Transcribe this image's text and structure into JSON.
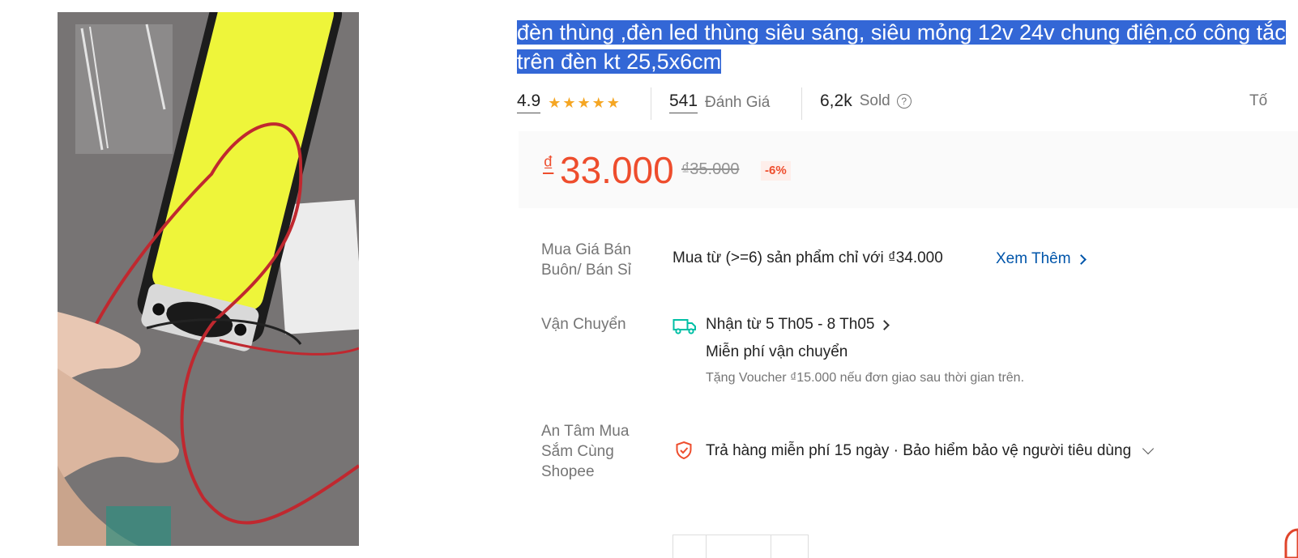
{
  "product": {
    "title": "đèn thùng ,đèn led thùng siêu sáng, siêu mỏng 12v 24v chung điện,có công tắc trên đèn kt 25,5x6cm"
  },
  "stats": {
    "rating": "4.9",
    "stars_filled": 5,
    "reviews_count": "541",
    "reviews_label": "Đánh Giá",
    "sold_count": "6,2k",
    "sold_label": "Sold",
    "help_icon": "question-circle-icon",
    "report_partial": "Tố"
  },
  "price": {
    "currency": "₫",
    "current": "33.000",
    "original": "₫35.000",
    "discount": "-6%"
  },
  "wholesale": {
    "label": "Mua Giá Bán Buôn/ Bán Sỉ",
    "text": "Mua từ (>=6) sản phẩm chỉ với ₫34.000",
    "link": "Xem Thêm"
  },
  "shipping": {
    "label": "Vận Chuyển",
    "icon": "truck-icon",
    "delivery": "Nhận từ 5 Th05 - 8 Th05",
    "free_shipping": "Miễn phí vận chuyển",
    "voucher_note": "Tặng Voucher ₫15.000 nếu đơn giao sau thời gian trên."
  },
  "guarantee": {
    "label": "An Tâm Mua Sắm Cùng Shopee",
    "icon": "shield-check-icon",
    "text": "Trả hàng miễn phí 15 ngày · Bảo hiểm bảo vệ người tiêu dùng"
  },
  "colors": {
    "accent": "#ee4d2d",
    "link": "#0055aa",
    "selection": "#3367d6",
    "star": "#f5a623",
    "shipping_icon": "#00bfa5"
  }
}
